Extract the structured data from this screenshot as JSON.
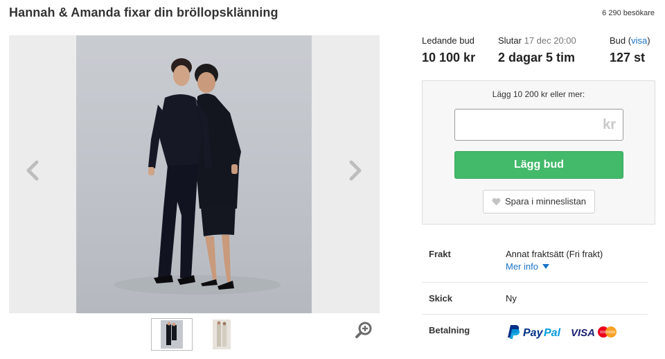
{
  "listing": {
    "title": "Hannah & Amanda fixar din bröllopsklänning",
    "visitors": "6 290 besökare"
  },
  "gallery": {
    "prev_icon": "chevron-left-icon",
    "next_icon": "chevron-right-icon",
    "zoom_icon": "zoom-in-icon",
    "thumbnails": [
      "thumb-1",
      "thumb-2"
    ]
  },
  "bid_info": {
    "leading_label": "Ledande bud",
    "leading_value": "10 100 kr",
    "ends_label": "Slutar",
    "ends_date": "17 dec 20:00",
    "ends_value": "2 dagar 5 tim",
    "bids_label": "Bud",
    "bids_link": "visa",
    "bids_value": "127 st"
  },
  "bid_box": {
    "prompt": "Lägg 10 200 kr eller mer:",
    "input_value": "",
    "input_placeholder": "",
    "unit": "kr",
    "submit_label": "Lägg bud",
    "save_label": "Spara i minneslistan"
  },
  "details": {
    "shipping_label": "Frakt",
    "shipping_value": "Annat fraktsätt (Fri frakt)",
    "more_info": "Mer info",
    "condition_label": "Skick",
    "condition_value": "Ny",
    "payment_label": "Betalning",
    "payment_methods": [
      "PayPal",
      "VISA",
      "MasterCard"
    ]
  },
  "colors": {
    "bid_button": "#43b96a",
    "link": "#1a73c8",
    "paypal_dark": "#003087",
    "paypal_light": "#009cde",
    "visa": "#1a1f71"
  }
}
